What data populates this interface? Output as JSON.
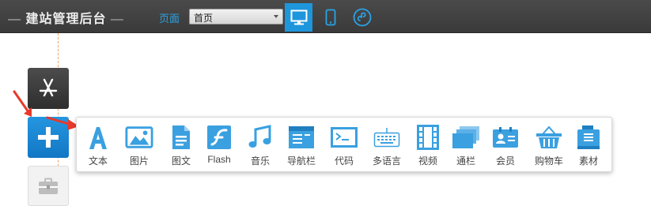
{
  "header": {
    "title": "建站管理后台",
    "title_dash": "—",
    "page_label": "页面",
    "page_select_value": "首页"
  },
  "devices": [
    {
      "name": "desktop",
      "active": true
    },
    {
      "name": "mobile",
      "active": false
    },
    {
      "name": "mini-program",
      "active": false
    }
  ],
  "sidebar": {
    "buttons": [
      {
        "name": "app-store",
        "icon": "app-store-icon"
      },
      {
        "name": "add",
        "icon": "plus-icon"
      },
      {
        "name": "toolbox",
        "icon": "toolbox-icon"
      }
    ]
  },
  "components": [
    {
      "label": "文本",
      "icon": "text-icon"
    },
    {
      "label": "图片",
      "icon": "image-icon"
    },
    {
      "label": "图文",
      "icon": "document-icon"
    },
    {
      "label": "Flash",
      "icon": "flash-icon"
    },
    {
      "label": "音乐",
      "icon": "music-icon"
    },
    {
      "label": "导航栏",
      "icon": "navbar-icon"
    },
    {
      "label": "代码",
      "icon": "code-icon"
    },
    {
      "label": "多语言",
      "icon": "keyboard-icon"
    },
    {
      "label": "视频",
      "icon": "video-icon"
    },
    {
      "label": "通栏",
      "icon": "banner-icon"
    },
    {
      "label": "会员",
      "icon": "member-icon"
    },
    {
      "label": "购物车",
      "icon": "cart-icon"
    },
    {
      "label": "素材",
      "icon": "assets-icon"
    }
  ],
  "colors": {
    "accent": "#2aa3e6",
    "active_device": "#1e96dc",
    "icon": "#3aa0e0",
    "topbar": "#3f3f3f",
    "arrow": "#e8392b"
  }
}
